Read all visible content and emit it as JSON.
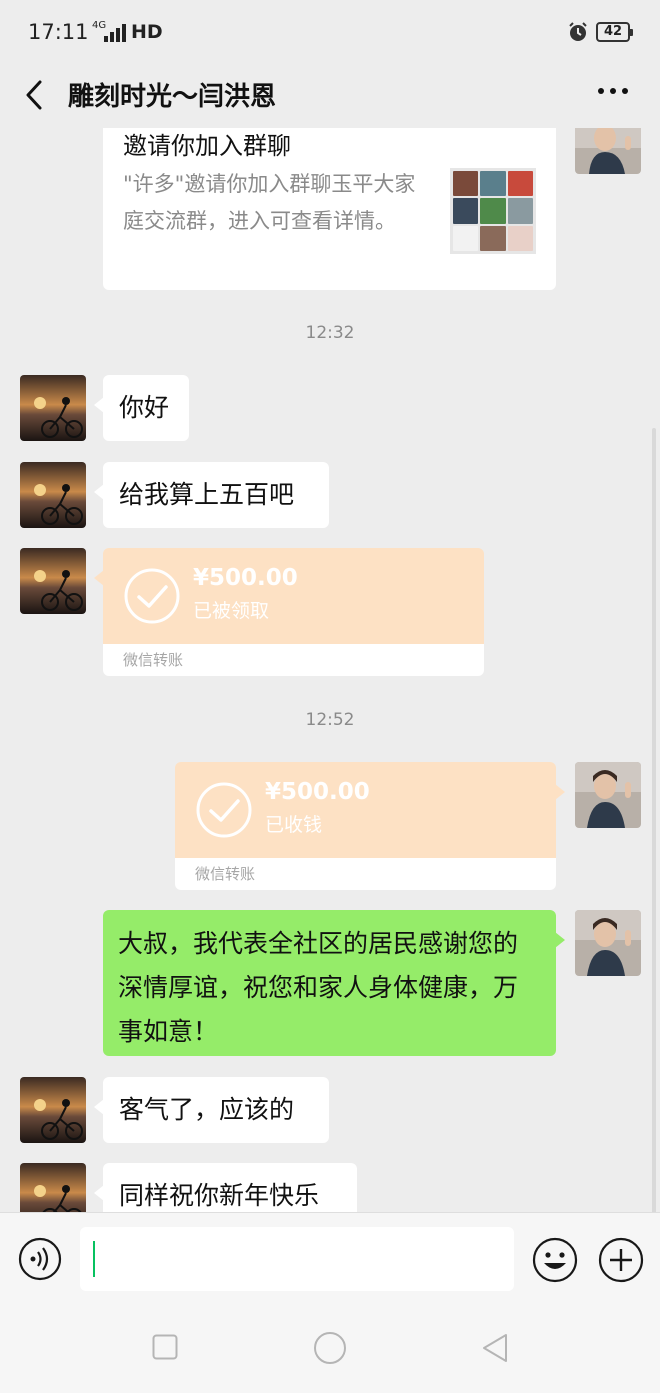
{
  "status_bar": {
    "time": "17:11",
    "network": "4G",
    "hd": "HD",
    "battery": "42"
  },
  "header": {
    "title": "雕刻时光～闫洪恩"
  },
  "invite_card": {
    "title": "邀请你加入群聊",
    "description": "\"许多\"邀请你加入群聊玉平大家庭交流群，进入可查看详情。"
  },
  "timestamps": [
    "12:32",
    "12:52"
  ],
  "messages": {
    "m1": "你好",
    "m2": "给我算上五百吧",
    "transfer1": {
      "amount": "¥500.00",
      "status": "已被领取",
      "footer": "微信转账"
    },
    "transfer2": {
      "amount": "¥500.00",
      "status": "已收钱",
      "footer": "微信转账"
    },
    "m3": "大叔，我代表全社区的居民感谢您的深情厚谊，祝您和家人身体健康，万事如意！",
    "m4": "客气了，应该的",
    "m5": "同样祝你新年快乐"
  },
  "input": {
    "placeholder": ""
  },
  "colors": {
    "background": "#ededed",
    "sent_bubble": "#95ec69",
    "received_bubble": "#ffffff",
    "transfer_card": "#fde1c4",
    "cursor": "#07c160"
  }
}
